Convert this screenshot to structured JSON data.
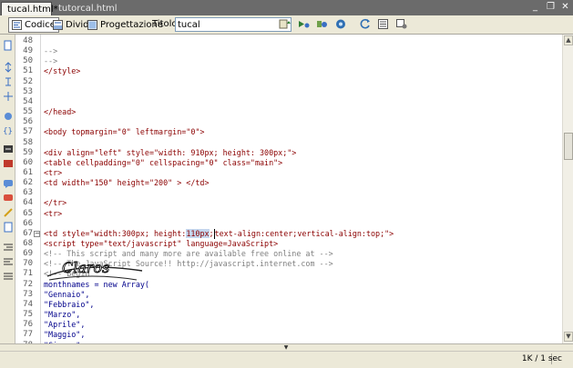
{
  "tabs": [
    {
      "label": "tucal.html*",
      "active": true
    },
    {
      "label": "tutorcal.html",
      "active": false
    }
  ],
  "window_controls": {
    "minimize": "_",
    "restore": "❐",
    "close": "✕"
  },
  "toolbar": {
    "code_label": "Codice",
    "split_label": "Dividi",
    "design_label": "Progettazione",
    "title_label": "Titolo:",
    "title_value": "tucal"
  },
  "code_lines": [
    {
      "n": "48",
      "parts": [
        {
          "c": "comment",
          "t": ""
        }
      ]
    },
    {
      "n": "49",
      "parts": [
        {
          "c": "comment",
          "t": "-->"
        }
      ]
    },
    {
      "n": "50",
      "parts": [
        {
          "c": "comment",
          "t": "-->"
        }
      ]
    },
    {
      "n": "51",
      "parts": [
        {
          "c": "tag",
          "t": "</style>"
        }
      ]
    },
    {
      "n": "52",
      "parts": [
        {
          "c": "tag",
          "t": ""
        }
      ]
    },
    {
      "n": "53",
      "parts": [
        {
          "c": "tag",
          "t": ""
        }
      ]
    },
    {
      "n": "54",
      "parts": [
        {
          "c": "tag",
          "t": ""
        }
      ]
    },
    {
      "n": "55",
      "parts": [
        {
          "c": "tag",
          "t": "</head>"
        }
      ]
    },
    {
      "n": "56",
      "parts": [
        {
          "c": "tag",
          "t": ""
        }
      ]
    },
    {
      "n": "57",
      "parts": [
        {
          "c": "tag",
          "t": "<body topmargin=\"0\" leftmargin=\"0\">"
        }
      ]
    },
    {
      "n": "58",
      "parts": [
        {
          "c": "tag",
          "t": ""
        }
      ]
    },
    {
      "n": "59",
      "parts": [
        {
          "c": "tag",
          "t": "<div align=\"left\" style=\"width: 910px; height: 300px;\">"
        }
      ]
    },
    {
      "n": "60",
      "parts": [
        {
          "c": "tag",
          "t": "<table cellpadding=\"0\" cellspacing=\"0\" class=\"main\">"
        }
      ]
    },
    {
      "n": "61",
      "parts": [
        {
          "c": "tag",
          "t": "<tr>"
        }
      ]
    },
    {
      "n": "62",
      "parts": [
        {
          "c": "tag",
          "t": "<td width=\"150\" height=\"200\" > </td>"
        }
      ]
    },
    {
      "n": "63",
      "parts": [
        {
          "c": "tag",
          "t": ""
        }
      ]
    },
    {
      "n": "64",
      "parts": [
        {
          "c": "tag",
          "t": "</tr>"
        }
      ]
    },
    {
      "n": "65",
      "parts": [
        {
          "c": "tag",
          "t": "<tr>"
        }
      ]
    },
    {
      "n": "66",
      "parts": [
        {
          "c": "tag",
          "t": ""
        }
      ]
    },
    {
      "n": "67",
      "parts": [
        {
          "c": "tag",
          "t": "<td style=\"width:300px; height:"
        },
        {
          "c": "tag hl",
          "t": "110px"
        },
        {
          "c": "tag",
          "t": ";"
        },
        {
          "c": "caret",
          "t": ""
        },
        {
          "c": "tag",
          "t": "text-align:center;vertical-align:top;\">"
        }
      ]
    },
    {
      "n": "68",
      "parts": [
        {
          "c": "tag",
          "t": "<script type=\"text/javascript\" language=JavaScript>"
        }
      ]
    },
    {
      "n": "69",
      "parts": [
        {
          "c": "comment",
          "t": "<!-- This script and many more are available free online at -->"
        }
      ]
    },
    {
      "n": "70",
      "parts": [
        {
          "c": "comment",
          "t": "<!-- The JavaScript Source!! http://javascript.internet.com -->"
        }
      ]
    },
    {
      "n": "71",
      "parts": [
        {
          "c": "comment",
          "t": "<!-- Begin"
        }
      ]
    },
    {
      "n": "72",
      "parts": [
        {
          "c": "js",
          "t": "monthnames = new Array("
        }
      ]
    },
    {
      "n": "73",
      "parts": [
        {
          "c": "str",
          "t": "\"Gennaio\","
        }
      ]
    },
    {
      "n": "74",
      "parts": [
        {
          "c": "str",
          "t": "\"Febbraio\","
        }
      ]
    },
    {
      "n": "75",
      "parts": [
        {
          "c": "str",
          "t": "\"Marzo\","
        }
      ]
    },
    {
      "n": "76",
      "parts": [
        {
          "c": "str",
          "t": "\"Aprile\","
        }
      ]
    },
    {
      "n": "77",
      "parts": [
        {
          "c": "str",
          "t": "\"Maggio\","
        }
      ]
    },
    {
      "n": "78",
      "parts": [
        {
          "c": "str",
          "t": "\"Giugno\","
        }
      ]
    }
  ],
  "watermark": "Claros",
  "status": {
    "size_time": "1K / 1 sec"
  }
}
